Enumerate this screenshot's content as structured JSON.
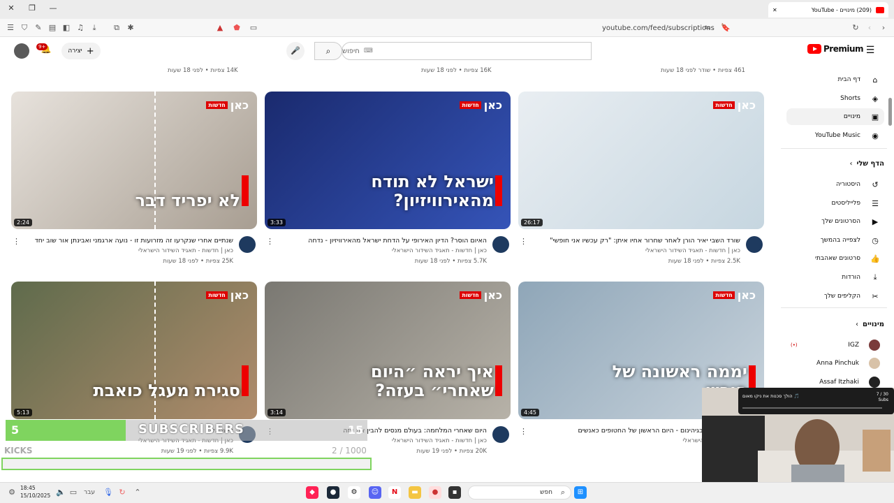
{
  "browser": {
    "tab_title": "(209) מינויים - YouTube",
    "url": "youtube.com/feed/subscriptions"
  },
  "header": {
    "search_placeholder": "חיפוש",
    "create_label": "יצירה",
    "notif_count": "9+",
    "logo_text": "Premium"
  },
  "sidebar": {
    "main": [
      {
        "label": "דף הבית",
        "icon": "home-icon",
        "glyph": "⌂"
      },
      {
        "label": "Shorts",
        "icon": "shorts-icon",
        "glyph": "◈"
      },
      {
        "label": "מינויים",
        "icon": "subscriptions-icon",
        "glyph": "▣"
      },
      {
        "label": "YouTube Music",
        "icon": "music-icon",
        "glyph": "◉"
      }
    ],
    "you_header": "הדף שלי",
    "you": [
      {
        "label": "היסטוריה",
        "icon": "history-icon",
        "glyph": "↺"
      },
      {
        "label": "פלייליסטים",
        "icon": "playlists-icon",
        "glyph": "☰"
      },
      {
        "label": "הסרטונים שלך",
        "icon": "your-videos-icon",
        "glyph": "▶"
      },
      {
        "label": "לצפייה בהמשך",
        "icon": "watch-later-icon",
        "glyph": "◷"
      },
      {
        "label": "סרטונים שאהבתי",
        "icon": "liked-icon",
        "glyph": "👍"
      },
      {
        "label": "הורדות",
        "icon": "downloads-icon",
        "glyph": "⤓"
      },
      {
        "label": "הקליפים שלך",
        "icon": "clips-icon",
        "glyph": "✂"
      }
    ],
    "subs_header": "מינויים",
    "subs": [
      {
        "label": "IGZ",
        "live": "(•)"
      },
      {
        "label": "Anna Pinchuk",
        "live": ""
      },
      {
        "label": "Assaf Itzhaki",
        "live": ""
      }
    ]
  },
  "top_row_meta": [
    "461 צפיות • שודר לפני 18 שעות",
    "16K צפיות • לפני 18 שעות",
    "14K צפיות • לפני 18 שעות"
  ],
  "videos_row1": [
    {
      "title": "שורד השבי יאיר הורן לאחר שחרור אחיו איתן: \"רק עכשיו אני חופשי\"",
      "channel": "כאן | חדשות - תאגיד השידור הישראלי",
      "meta": "2.5K צפיות • לפני 18 שעות",
      "duration": "26:17",
      "overlay": "",
      "logo": "כאן",
      "news": "חדשות"
    },
    {
      "title": "האיום הוסר? הדיון האירופי על הדחת ישראל מהאירוויזיון - נדחה",
      "channel": "כאן | חדשות - תאגיד השידור הישראלי",
      "meta": "5.7K צפיות • לפני 18 שעות",
      "duration": "3:33",
      "overlay": "ישראל לא תודח מהאירוויזיון?",
      "logo": "כאן",
      "news": "חדשות"
    },
    {
      "title": "שנתיים אחרי שנקרעו זה מזרועות זו - נועה ארגמני ואבינתן אור שוב יחד",
      "channel": "כאן | חדשות - תאגיד השידור הישראלי",
      "meta": "25K צפיות • לפני 18 שעות",
      "duration": "2:24",
      "overlay": "לא יפריד דבר",
      "logo": "כאן",
      "news": "חדשות"
    }
  ],
  "videos_row2": [
    {
      "title": "אחרי שנתיים בגיהינום - היום הראשון של החטופים כאנשים",
      "channel": "תאגיד השידור הישראלי",
      "meta": "",
      "duration": "4:45",
      "overlay": "יממה ראשונה של חופש",
      "logo": "כאן",
      "news": "חדשות"
    },
    {
      "title": "היום שאחרי המלחמה: בעולם מנסים להבין את עזה",
      "channel": "כאן | חדשות - תאגיד השידור הישראלי",
      "meta": "20K צפיות • לפני 19 שעות",
      "duration": "3:14",
      "overlay": "איך יראה ״היום שאחרי״ בעזה?",
      "logo": "כאן",
      "news": "חדשות"
    },
    {
      "title": "לישראל",
      "channel": "כאן | חדשות - תאגיד השידור הישראלי",
      "meta": "9.9K צפיות • לפני 19 שעות",
      "duration": "5:13",
      "overlay": "סגירת מעגל כואבת",
      "logo": "כאן",
      "news": "חדשות"
    }
  ],
  "stream_overlay": {
    "sub_count": "5",
    "sub_label": "SUBSCRIBERS",
    "sub_goal": "15",
    "sub_progress": 0.333,
    "kicks_label": "KICKS",
    "kicks_value": "2 / 1000",
    "kicks_progress": 0.002
  },
  "popup": {
    "title": "הולך סכנות את ניקו מאום 🎵",
    "counter": "7 / 30",
    "sub": "Subs"
  },
  "taskbar": {
    "time": "18:45",
    "date": "15/10/2025",
    "lang": "עבר",
    "search": "חפש"
  },
  "colors": {
    "yt_red": "#ff0000",
    "kan_red": "#dd0000",
    "sub_green": "#7fd45f"
  }
}
